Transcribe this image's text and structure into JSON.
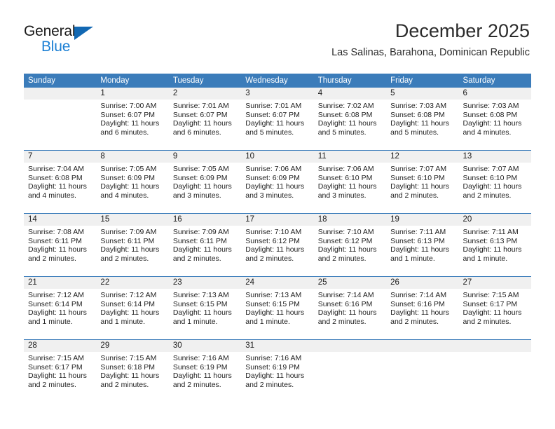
{
  "brand": {
    "name_top": "General",
    "name_bottom": "Blue",
    "accent_color": "#1b7fd4",
    "triangle_color": "#1268b3"
  },
  "header": {
    "title": "December 2025",
    "subtitle": "Las Salinas, Barahona, Dominican Republic"
  },
  "theme": {
    "header_row_bg": "#3b7cba",
    "day_band_bg": "#f0f0f0",
    "grid_line": "#3b7cba",
    "text": "#1f1f1f"
  },
  "weekdays": [
    "Sunday",
    "Monday",
    "Tuesday",
    "Wednesday",
    "Thursday",
    "Friday",
    "Saturday"
  ],
  "weeks": [
    [
      {
        "day": "",
        "sunrise": "",
        "sunset": "",
        "daylight_1": "",
        "daylight_2": ""
      },
      {
        "day": "1",
        "sunrise": "Sunrise: 7:00 AM",
        "sunset": "Sunset: 6:07 PM",
        "daylight_1": "Daylight: 11 hours",
        "daylight_2": "and 6 minutes."
      },
      {
        "day": "2",
        "sunrise": "Sunrise: 7:01 AM",
        "sunset": "Sunset: 6:07 PM",
        "daylight_1": "Daylight: 11 hours",
        "daylight_2": "and 6 minutes."
      },
      {
        "day": "3",
        "sunrise": "Sunrise: 7:01 AM",
        "sunset": "Sunset: 6:07 PM",
        "daylight_1": "Daylight: 11 hours",
        "daylight_2": "and 5 minutes."
      },
      {
        "day": "4",
        "sunrise": "Sunrise: 7:02 AM",
        "sunset": "Sunset: 6:08 PM",
        "daylight_1": "Daylight: 11 hours",
        "daylight_2": "and 5 minutes."
      },
      {
        "day": "5",
        "sunrise": "Sunrise: 7:03 AM",
        "sunset": "Sunset: 6:08 PM",
        "daylight_1": "Daylight: 11 hours",
        "daylight_2": "and 5 minutes."
      },
      {
        "day": "6",
        "sunrise": "Sunrise: 7:03 AM",
        "sunset": "Sunset: 6:08 PM",
        "daylight_1": "Daylight: 11 hours",
        "daylight_2": "and 4 minutes."
      }
    ],
    [
      {
        "day": "7",
        "sunrise": "Sunrise: 7:04 AM",
        "sunset": "Sunset: 6:08 PM",
        "daylight_1": "Daylight: 11 hours",
        "daylight_2": "and 4 minutes."
      },
      {
        "day": "8",
        "sunrise": "Sunrise: 7:05 AM",
        "sunset": "Sunset: 6:09 PM",
        "daylight_1": "Daylight: 11 hours",
        "daylight_2": "and 4 minutes."
      },
      {
        "day": "9",
        "sunrise": "Sunrise: 7:05 AM",
        "sunset": "Sunset: 6:09 PM",
        "daylight_1": "Daylight: 11 hours",
        "daylight_2": "and 3 minutes."
      },
      {
        "day": "10",
        "sunrise": "Sunrise: 7:06 AM",
        "sunset": "Sunset: 6:09 PM",
        "daylight_1": "Daylight: 11 hours",
        "daylight_2": "and 3 minutes."
      },
      {
        "day": "11",
        "sunrise": "Sunrise: 7:06 AM",
        "sunset": "Sunset: 6:10 PM",
        "daylight_1": "Daylight: 11 hours",
        "daylight_2": "and 3 minutes."
      },
      {
        "day": "12",
        "sunrise": "Sunrise: 7:07 AM",
        "sunset": "Sunset: 6:10 PM",
        "daylight_1": "Daylight: 11 hours",
        "daylight_2": "and 2 minutes."
      },
      {
        "day": "13",
        "sunrise": "Sunrise: 7:07 AM",
        "sunset": "Sunset: 6:10 PM",
        "daylight_1": "Daylight: 11 hours",
        "daylight_2": "and 2 minutes."
      }
    ],
    [
      {
        "day": "14",
        "sunrise": "Sunrise: 7:08 AM",
        "sunset": "Sunset: 6:11 PM",
        "daylight_1": "Daylight: 11 hours",
        "daylight_2": "and 2 minutes."
      },
      {
        "day": "15",
        "sunrise": "Sunrise: 7:09 AM",
        "sunset": "Sunset: 6:11 PM",
        "daylight_1": "Daylight: 11 hours",
        "daylight_2": "and 2 minutes."
      },
      {
        "day": "16",
        "sunrise": "Sunrise: 7:09 AM",
        "sunset": "Sunset: 6:11 PM",
        "daylight_1": "Daylight: 11 hours",
        "daylight_2": "and 2 minutes."
      },
      {
        "day": "17",
        "sunrise": "Sunrise: 7:10 AM",
        "sunset": "Sunset: 6:12 PM",
        "daylight_1": "Daylight: 11 hours",
        "daylight_2": "and 2 minutes."
      },
      {
        "day": "18",
        "sunrise": "Sunrise: 7:10 AM",
        "sunset": "Sunset: 6:12 PM",
        "daylight_1": "Daylight: 11 hours",
        "daylight_2": "and 2 minutes."
      },
      {
        "day": "19",
        "sunrise": "Sunrise: 7:11 AM",
        "sunset": "Sunset: 6:13 PM",
        "daylight_1": "Daylight: 11 hours",
        "daylight_2": "and 1 minute."
      },
      {
        "day": "20",
        "sunrise": "Sunrise: 7:11 AM",
        "sunset": "Sunset: 6:13 PM",
        "daylight_1": "Daylight: 11 hours",
        "daylight_2": "and 1 minute."
      }
    ],
    [
      {
        "day": "21",
        "sunrise": "Sunrise: 7:12 AM",
        "sunset": "Sunset: 6:14 PM",
        "daylight_1": "Daylight: 11 hours",
        "daylight_2": "and 1 minute."
      },
      {
        "day": "22",
        "sunrise": "Sunrise: 7:12 AM",
        "sunset": "Sunset: 6:14 PM",
        "daylight_1": "Daylight: 11 hours",
        "daylight_2": "and 1 minute."
      },
      {
        "day": "23",
        "sunrise": "Sunrise: 7:13 AM",
        "sunset": "Sunset: 6:15 PM",
        "daylight_1": "Daylight: 11 hours",
        "daylight_2": "and 1 minute."
      },
      {
        "day": "24",
        "sunrise": "Sunrise: 7:13 AM",
        "sunset": "Sunset: 6:15 PM",
        "daylight_1": "Daylight: 11 hours",
        "daylight_2": "and 1 minute."
      },
      {
        "day": "25",
        "sunrise": "Sunrise: 7:14 AM",
        "sunset": "Sunset: 6:16 PM",
        "daylight_1": "Daylight: 11 hours",
        "daylight_2": "and 2 minutes."
      },
      {
        "day": "26",
        "sunrise": "Sunrise: 7:14 AM",
        "sunset": "Sunset: 6:16 PM",
        "daylight_1": "Daylight: 11 hours",
        "daylight_2": "and 2 minutes."
      },
      {
        "day": "27",
        "sunrise": "Sunrise: 7:15 AM",
        "sunset": "Sunset: 6:17 PM",
        "daylight_1": "Daylight: 11 hours",
        "daylight_2": "and 2 minutes."
      }
    ],
    [
      {
        "day": "28",
        "sunrise": "Sunrise: 7:15 AM",
        "sunset": "Sunset: 6:17 PM",
        "daylight_1": "Daylight: 11 hours",
        "daylight_2": "and 2 minutes."
      },
      {
        "day": "29",
        "sunrise": "Sunrise: 7:15 AM",
        "sunset": "Sunset: 6:18 PM",
        "daylight_1": "Daylight: 11 hours",
        "daylight_2": "and 2 minutes."
      },
      {
        "day": "30",
        "sunrise": "Sunrise: 7:16 AM",
        "sunset": "Sunset: 6:19 PM",
        "daylight_1": "Daylight: 11 hours",
        "daylight_2": "and 2 minutes."
      },
      {
        "day": "31",
        "sunrise": "Sunrise: 7:16 AM",
        "sunset": "Sunset: 6:19 PM",
        "daylight_1": "Daylight: 11 hours",
        "daylight_2": "and 2 minutes."
      },
      {
        "day": "",
        "sunrise": "",
        "sunset": "",
        "daylight_1": "",
        "daylight_2": ""
      },
      {
        "day": "",
        "sunrise": "",
        "sunset": "",
        "daylight_1": "",
        "daylight_2": ""
      },
      {
        "day": "",
        "sunrise": "",
        "sunset": "",
        "daylight_1": "",
        "daylight_2": ""
      }
    ]
  ]
}
